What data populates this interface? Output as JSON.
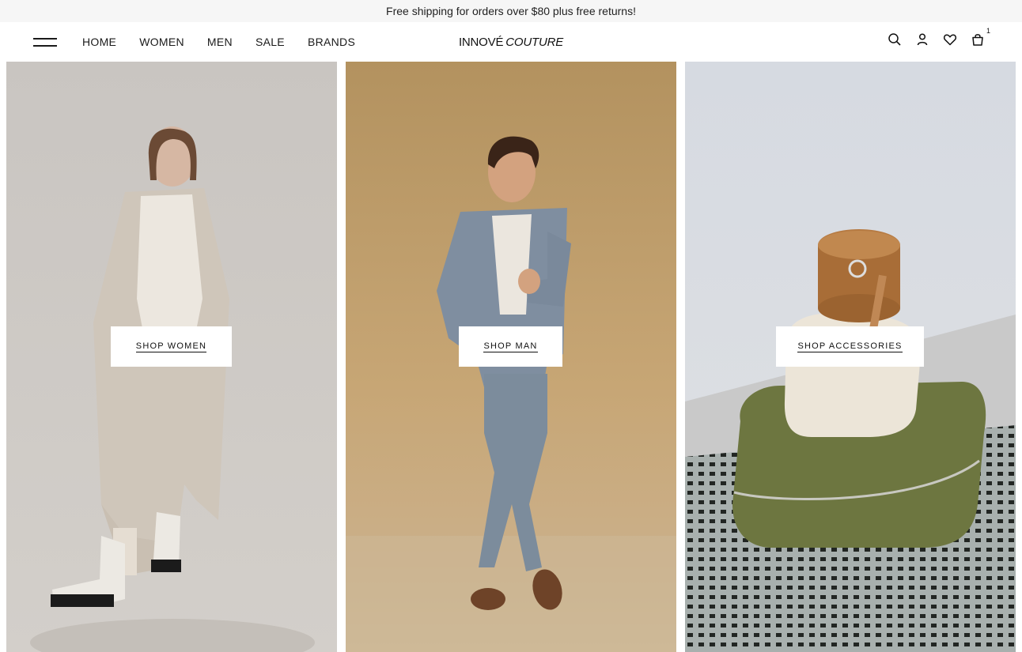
{
  "announcement": "Free shipping for orders over $80 plus free returns!",
  "header": {
    "nav": [
      "HOME",
      "WOMEN",
      "MEN",
      "SALE",
      "BRANDS"
    ],
    "logo_main": "INNOVÉ",
    "logo_script": "COUTURE",
    "icons": [
      "search-icon",
      "account-icon",
      "wishlist-icon",
      "cart-icon"
    ],
    "cart_count": "1"
  },
  "panels": [
    {
      "cta": "SHOP WOMEN",
      "bg_color": "#cdc9c4"
    },
    {
      "cta": "SHOP MAN",
      "bg_color": "#c2a275"
    },
    {
      "cta": "SHOP ACCESSORIES",
      "bg_color": "#d9dce0"
    }
  ],
  "colors": {
    "text": "#1a1a1a",
    "announcement_bg": "#f6f6f6",
    "cta_bg": "#ffffff"
  }
}
